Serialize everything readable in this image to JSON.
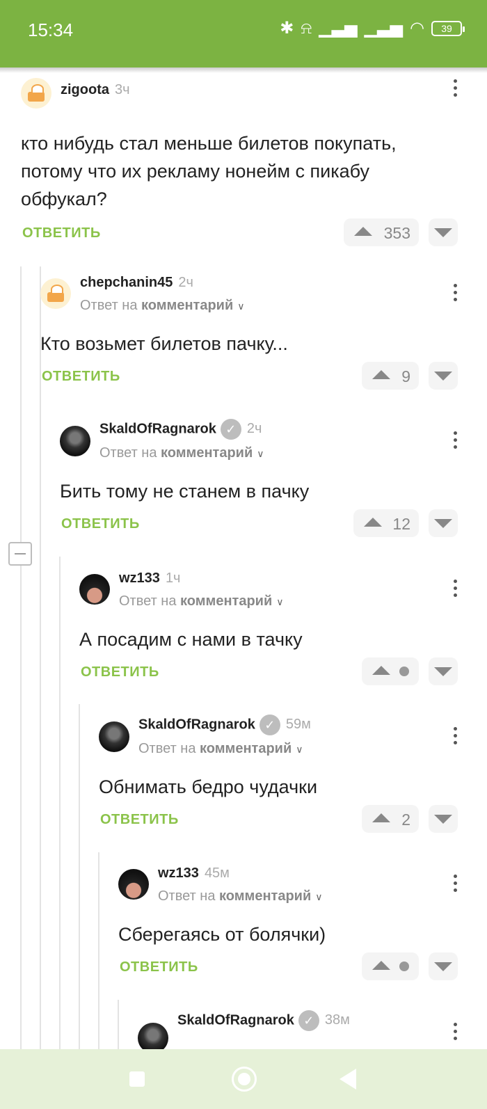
{
  "status_bar": {
    "time": "15:34",
    "battery": "39",
    "icons": [
      "bluetooth-icon",
      "silent-icon",
      "signal-icon",
      "signal-icon",
      "wifi-icon",
      "battery-icon"
    ]
  },
  "labels": {
    "reply_to_prefix": "Ответ на",
    "reply_to_target": "комментарий",
    "reply_button": "ОТВЕТИТЬ"
  },
  "comments": [
    {
      "user": "zigoota",
      "time": "3ч",
      "text": "кто нибудь стал меньше билетов покупать, потому что их рекламу нонейм с пикабу обфукал?",
      "rating": "353",
      "verified": false,
      "is_reply": false
    },
    {
      "user": "chepchanin45",
      "time": "2ч",
      "text": "Кто возьмет билетов пачку...",
      "rating": "9",
      "verified": false,
      "is_reply": true
    },
    {
      "user": "SkaldOfRagnarok",
      "time": "2ч",
      "text": "Бить тому не станем в пачку",
      "rating": "12",
      "verified": true,
      "is_reply": true
    },
    {
      "user": "wz133",
      "time": "1ч",
      "text": "А посадим с нами в тачку",
      "rating": "",
      "verified": false,
      "is_reply": true
    },
    {
      "user": "SkaldOfRagnarok",
      "time": "59м",
      "text": "Обнимать бедро чудачки",
      "rating": "2",
      "verified": true,
      "is_reply": true
    },
    {
      "user": "wz133",
      "time": "45м",
      "text": "Сберегаясь от болячки)",
      "rating": "",
      "verified": false,
      "is_reply": true
    },
    {
      "user": "SkaldOfRagnarok",
      "time": "38м",
      "text": "",
      "rating": "",
      "verified": true,
      "is_reply": true
    }
  ],
  "colors": {
    "brand": "#7cb342",
    "reply": "#8bc34a",
    "navbar": "#e6f1d8"
  }
}
